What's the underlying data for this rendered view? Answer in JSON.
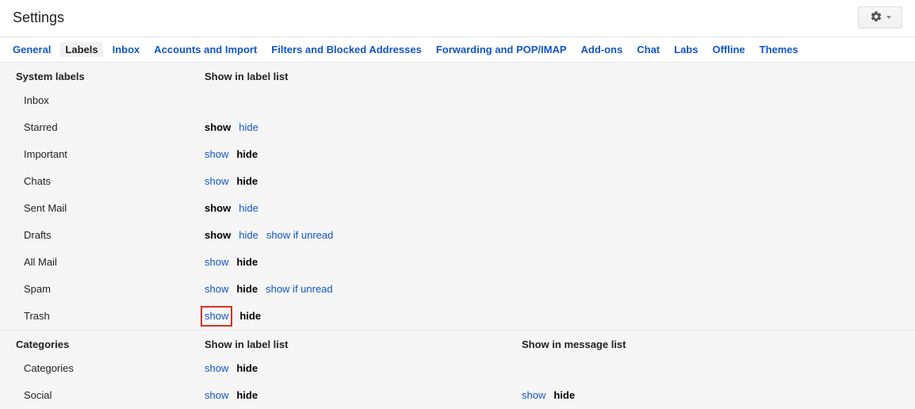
{
  "header": {
    "title": "Settings"
  },
  "tabs": [
    "General",
    "Labels",
    "Inbox",
    "Accounts and Import",
    "Filters and Blocked Addresses",
    "Forwarding and POP/IMAP",
    "Add-ons",
    "Chat",
    "Labs",
    "Offline",
    "Themes"
  ],
  "active_tab": "Labels",
  "section_headers": {
    "system_labels": "System labels",
    "show_label_list": "Show in label list",
    "categories": "Categories",
    "show_msg_list": "Show in message list"
  },
  "action_text": {
    "show": "show",
    "hide": "hide",
    "show_if_unread": "show if unread"
  },
  "system_rows": [
    {
      "label": "Inbox",
      "show": "",
      "hide": "",
      "extra": "",
      "highlight": false
    },
    {
      "label": "Starred",
      "show": "bold",
      "hide": "link",
      "extra": "",
      "highlight": false
    },
    {
      "label": "Important",
      "show": "link",
      "hide": "bold",
      "extra": "",
      "highlight": false
    },
    {
      "label": "Chats",
      "show": "link",
      "hide": "bold",
      "extra": "",
      "highlight": false
    },
    {
      "label": "Sent Mail",
      "show": "bold",
      "hide": "link",
      "extra": "",
      "highlight": false
    },
    {
      "label": "Drafts",
      "show": "bold",
      "hide": "link",
      "extra": "show_if_unread",
      "highlight": false
    },
    {
      "label": "All Mail",
      "show": "link",
      "hide": "bold",
      "extra": "",
      "highlight": false
    },
    {
      "label": "Spam",
      "show": "link",
      "hide": "bold",
      "extra": "show_if_unread",
      "highlight": false
    },
    {
      "label": "Trash",
      "show": "link",
      "hide": "bold",
      "extra": "",
      "highlight": true
    }
  ],
  "category_rows": [
    {
      "label": "Categories",
      "show": "link",
      "hide": "bold",
      "msg_show": "",
      "msg_hide": ""
    },
    {
      "label": "Social",
      "show": "link",
      "hide": "bold",
      "msg_show": "link",
      "msg_hide": "bold"
    }
  ]
}
